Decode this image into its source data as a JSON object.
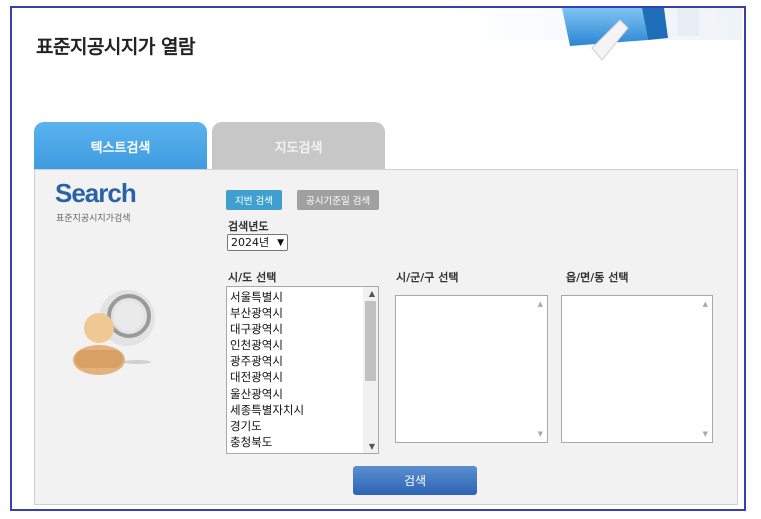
{
  "page": {
    "title": "표준지공시지가 열람"
  },
  "tabs": [
    {
      "label": "텍스트검색"
    },
    {
      "label": "지도검색"
    }
  ],
  "logo": {
    "word": "Search",
    "sub": "표준지공시지가검색"
  },
  "buttons": {
    "jibeon": "지번 검색",
    "date": "공시기준일 검색",
    "search": "검색"
  },
  "year": {
    "label": "검색년도",
    "value": "2024년"
  },
  "sido": {
    "label": "시/도 선택",
    "items": [
      "서울특별시",
      "부산광역시",
      "대구광역시",
      "인천광역시",
      "광주광역시",
      "대전광역시",
      "울산광역시",
      "세종특별자치시",
      "경기도",
      "충청북도"
    ]
  },
  "sgg": {
    "label": "시/군/구 선택"
  },
  "emd": {
    "label": "읍/면/동 선택"
  },
  "colors": {
    "frame": "#3a3fb0",
    "active_tab": "#4aa6e6",
    "inactive_tab": "#c7c7c7",
    "search_button": "#3a74c0",
    "logo": "#2a62a8"
  }
}
